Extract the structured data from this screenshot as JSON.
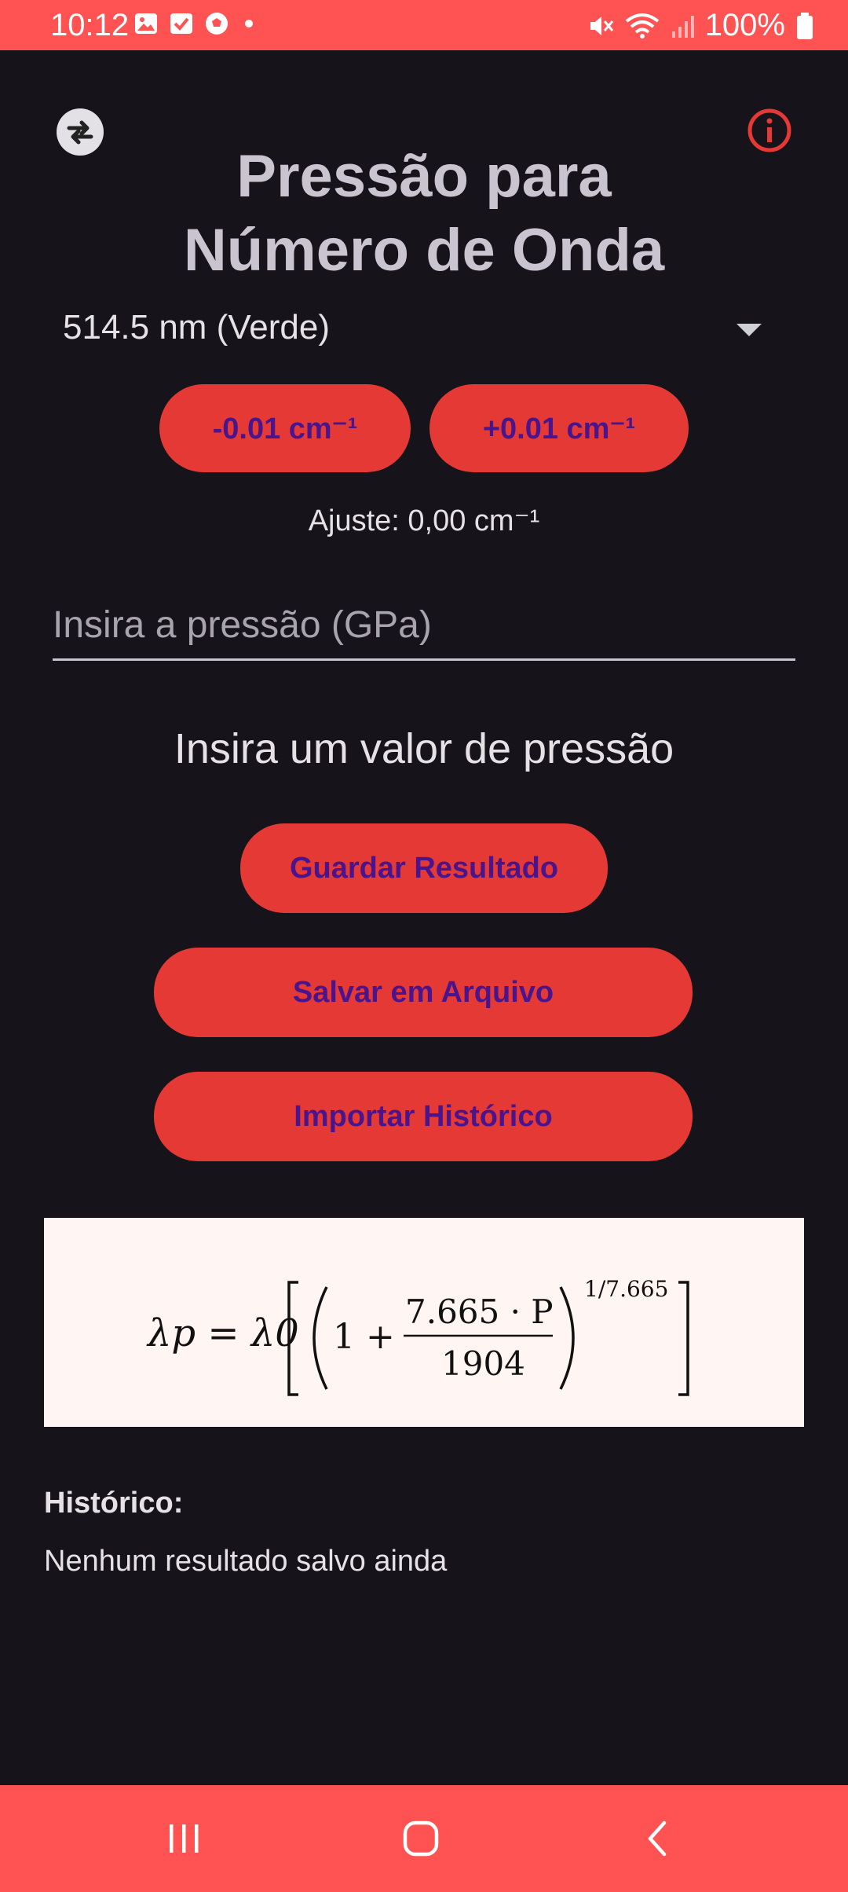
{
  "status_bar": {
    "time": "10:12",
    "battery": "100%",
    "notification_icons": [
      "image-icon",
      "check-icon",
      "soccer-ball-icon",
      "dot-icon"
    ],
    "system_icons": [
      "mute-icon",
      "wifi-icon",
      "signal-icon",
      "battery-icon"
    ]
  },
  "header": {
    "title_line1": "Pressão para",
    "title_line2": "Número de Onda",
    "swap_icon": "swap-icon",
    "info_icon": "info-icon"
  },
  "laser_select": {
    "selected": "514.5 nm (Verde)"
  },
  "adjust": {
    "minus_label": "-0.01 cm⁻¹",
    "plus_label": "+0.01 cm⁻¹",
    "value_text": "Ajuste: 0,00 cm⁻¹"
  },
  "pressure_input": {
    "placeholder": "Insira a pressão (GPa)",
    "value": ""
  },
  "result_message": "Insira um valor de pressão",
  "actions": {
    "save_result": "Guardar Resultado",
    "save_file": "Salvar em Arquivo",
    "import_history": "Importar Histórico"
  },
  "formula": {
    "lhs": "λp = λ0",
    "coefficient": "7.665 · P",
    "denominator": "1904",
    "exponent": "1/7.665"
  },
  "history": {
    "label": "Histórico:",
    "empty_text": "Nenhum resultado salvo ainda"
  },
  "colors": {
    "status_bar": "#ff5252",
    "button_bg": "#e53935",
    "button_text": "#4a148c",
    "background": "#16141a",
    "formula_bg": "#fff5f3"
  }
}
